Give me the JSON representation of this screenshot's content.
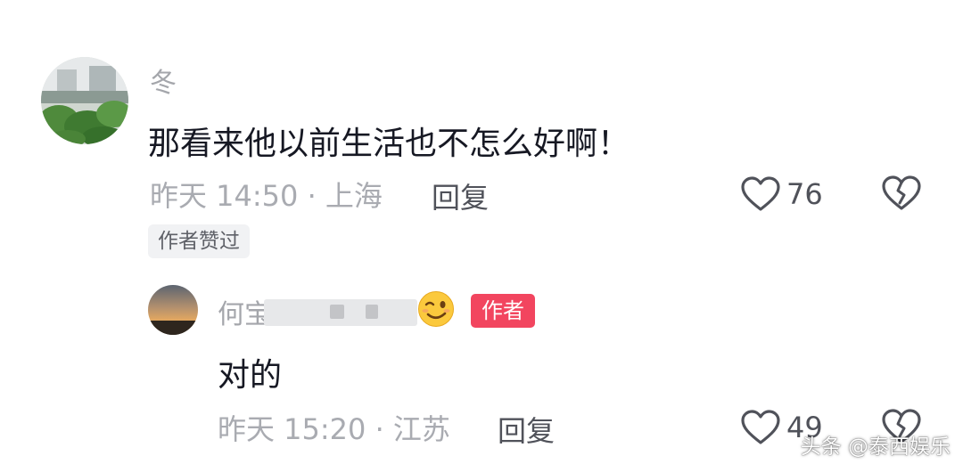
{
  "comments": [
    {
      "username": "冬",
      "content": "那看来他以前生活也不怎么好啊！",
      "meta": "昨天 14:50 · 上海",
      "reply_label": "回复",
      "like_count": "76",
      "liked_badge": "作者赞过"
    },
    {
      "username": "何宝",
      "author_badge": "作者",
      "content": "对的",
      "meta": "昨天 15:20 · 江苏",
      "reply_label": "回复",
      "like_count": "49"
    }
  ],
  "icons": {
    "like": "heart-outline-icon",
    "dislike": "broken-heart-icon",
    "emoji": "winking-face-emoji"
  },
  "colors": {
    "author_badge_bg": "#f2455f",
    "meta_text": "#a9abb1",
    "username_text": "#a4a6ab"
  },
  "watermark": "头条 @泰西娱乐"
}
